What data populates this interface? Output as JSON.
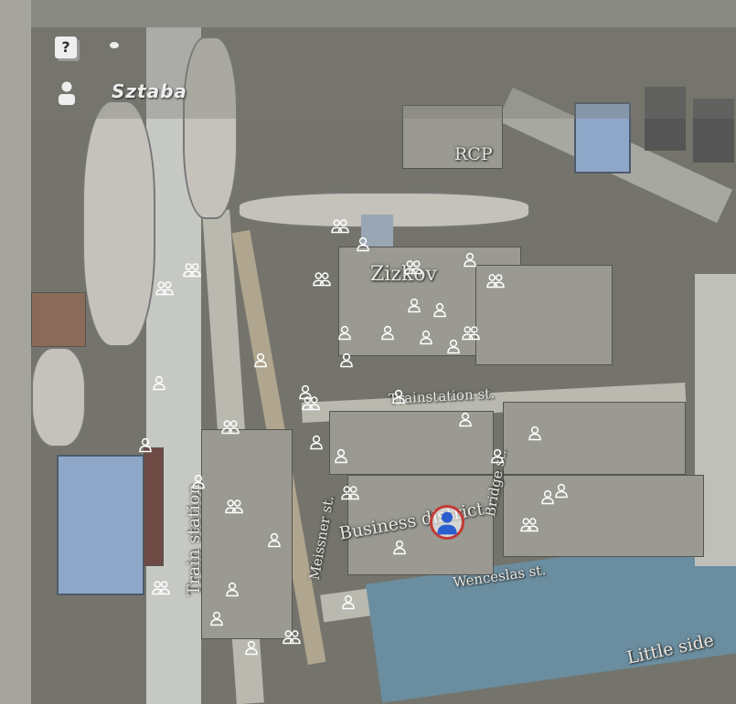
{
  "hud": {
    "help_icon": "question-book-icon",
    "player_name": "Sztaba"
  },
  "labels": {
    "rcp": "RCP",
    "zizkov": "Zizkov",
    "trainstation_st": "Trainstation st.",
    "bridge_st": "Bridge st.",
    "business_district": "Business district",
    "wenceslas_st": "Wenceslas st.",
    "meissner_st": "Meissner st.",
    "train_station": "Train station",
    "little_side": "Little side"
  },
  "colors": {
    "player_ring": "#c43a34",
    "player_icon": "#2b5fd0"
  }
}
